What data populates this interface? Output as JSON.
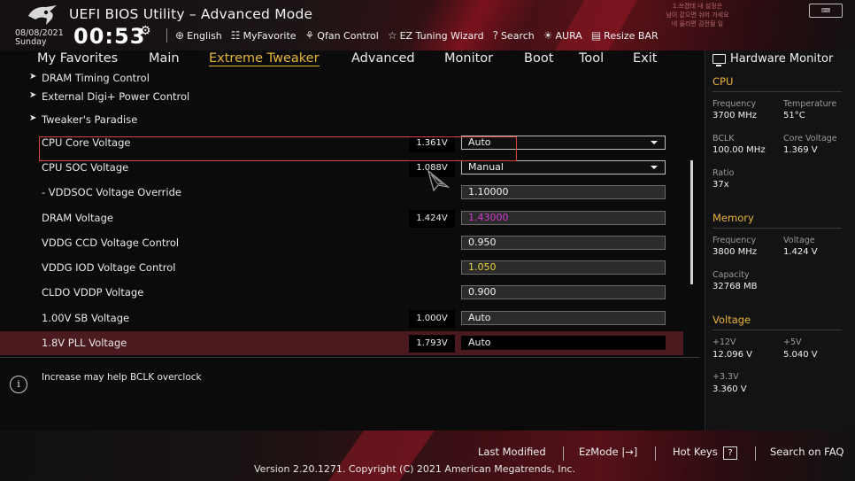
{
  "header": {
    "title": "UEFI BIOS Utility – Advanced Mode",
    "date": "08/08/2021",
    "day": "Sunday",
    "time": "00:53",
    "notice_lines": [
      "1.쓰겠데 내 설정은",
      "남이 같으면 쉬어 가세요",
      "네 올리면 감전될 일"
    ],
    "toolbar": [
      {
        "icon": "globe-icon",
        "glyph": "⊕",
        "label": "English"
      },
      {
        "icon": "favorite-icon",
        "glyph": "☷",
        "label": "MyFavorite"
      },
      {
        "icon": "fan-icon",
        "glyph": "⚘",
        "label": "Qfan Control"
      },
      {
        "icon": "bulb-icon",
        "glyph": "☆",
        "label": "EZ Tuning Wizard"
      },
      {
        "icon": "search-icon",
        "glyph": "?",
        "label": "Search"
      },
      {
        "icon": "aura-icon",
        "glyph": "☀",
        "label": "AURA"
      },
      {
        "icon": "resize-bar-icon",
        "glyph": "▤",
        "label": "Resize BAR"
      }
    ]
  },
  "menu": [
    "My Favorites",
    "Main",
    "Extreme Tweaker",
    "Advanced",
    "Monitor",
    "Boot",
    "Tool",
    "Exit"
  ],
  "active_menu": "Extreme Tweaker",
  "settings": [
    {
      "label": "DRAM Timing Control",
      "submenu": true
    },
    {
      "label": "External Digi+ Power Control",
      "submenu": true
    },
    {
      "label": "Tweaker's Paradise",
      "submenu": true
    },
    {
      "label": "CPU Core Voltage",
      "current": "1.361V",
      "value": "Auto",
      "dropdown": true
    },
    {
      "label": "CPU SOC Voltage",
      "current": "1.088V",
      "value": "Manual",
      "dropdown": true
    },
    {
      "label": "- VDDSOC Voltage Override",
      "value": "1.10000"
    },
    {
      "label": "DRAM Voltage",
      "current": "1.424V",
      "value": "1.43000",
      "value_color": "#d23bd0",
      "highlighted": true
    },
    {
      "label": "VDDG CCD Voltage Control",
      "value": "0.950"
    },
    {
      "label": "VDDG IOD Voltage Control",
      "value": "1.050",
      "value_color": "#e6d43a"
    },
    {
      "label": "CLDO VDDP Voltage",
      "value": "0.900"
    },
    {
      "label": "1.00V SB Voltage",
      "current": "1.000V",
      "value": "Auto"
    },
    {
      "label": "1.8V PLL Voltage",
      "current": "1.793V",
      "value": "Auto",
      "selected": true
    }
  ],
  "help_text": "Increase may help BCLK overclock",
  "hardware_monitor": {
    "title": "Hardware Monitor",
    "cpu": {
      "section": "CPU",
      "frequency_label": "Frequency",
      "frequency": "3700 MHz",
      "temperature_label": "Temperature",
      "temperature": "51°C",
      "bclk_label": "BCLK",
      "bclk": "100.00 MHz",
      "core_voltage_label": "Core Voltage",
      "core_voltage": "1.369 V",
      "ratio_label": "Ratio",
      "ratio": "37x"
    },
    "memory": {
      "section": "Memory",
      "frequency_label": "Frequency",
      "frequency": "3800 MHz",
      "voltage_label": "Voltage",
      "voltage": "1.424 V",
      "capacity_label": "Capacity",
      "capacity": "32768 MB"
    },
    "voltage": {
      "section": "Voltage",
      "v12_label": "+12V",
      "v12": "12.096 V",
      "v5_label": "+5V",
      "v5": "5.040 V",
      "v33_label": "+3.3V",
      "v33": "3.360 V"
    }
  },
  "footer": {
    "last_modified": "Last Modified",
    "ezmode": "EzMode",
    "ezmode_glyph": "|→]",
    "hot_keys": "Hot Keys",
    "hot_keys_glyph": "?",
    "search_faq": "Search on FAQ",
    "version": "Version 2.20.1271. Copyright (C) 2021 American Megatrends, Inc."
  },
  "colors": {
    "accent": "#e8b339",
    "brand_red": "#c0152a",
    "highlight_frame": "#d9433d"
  }
}
